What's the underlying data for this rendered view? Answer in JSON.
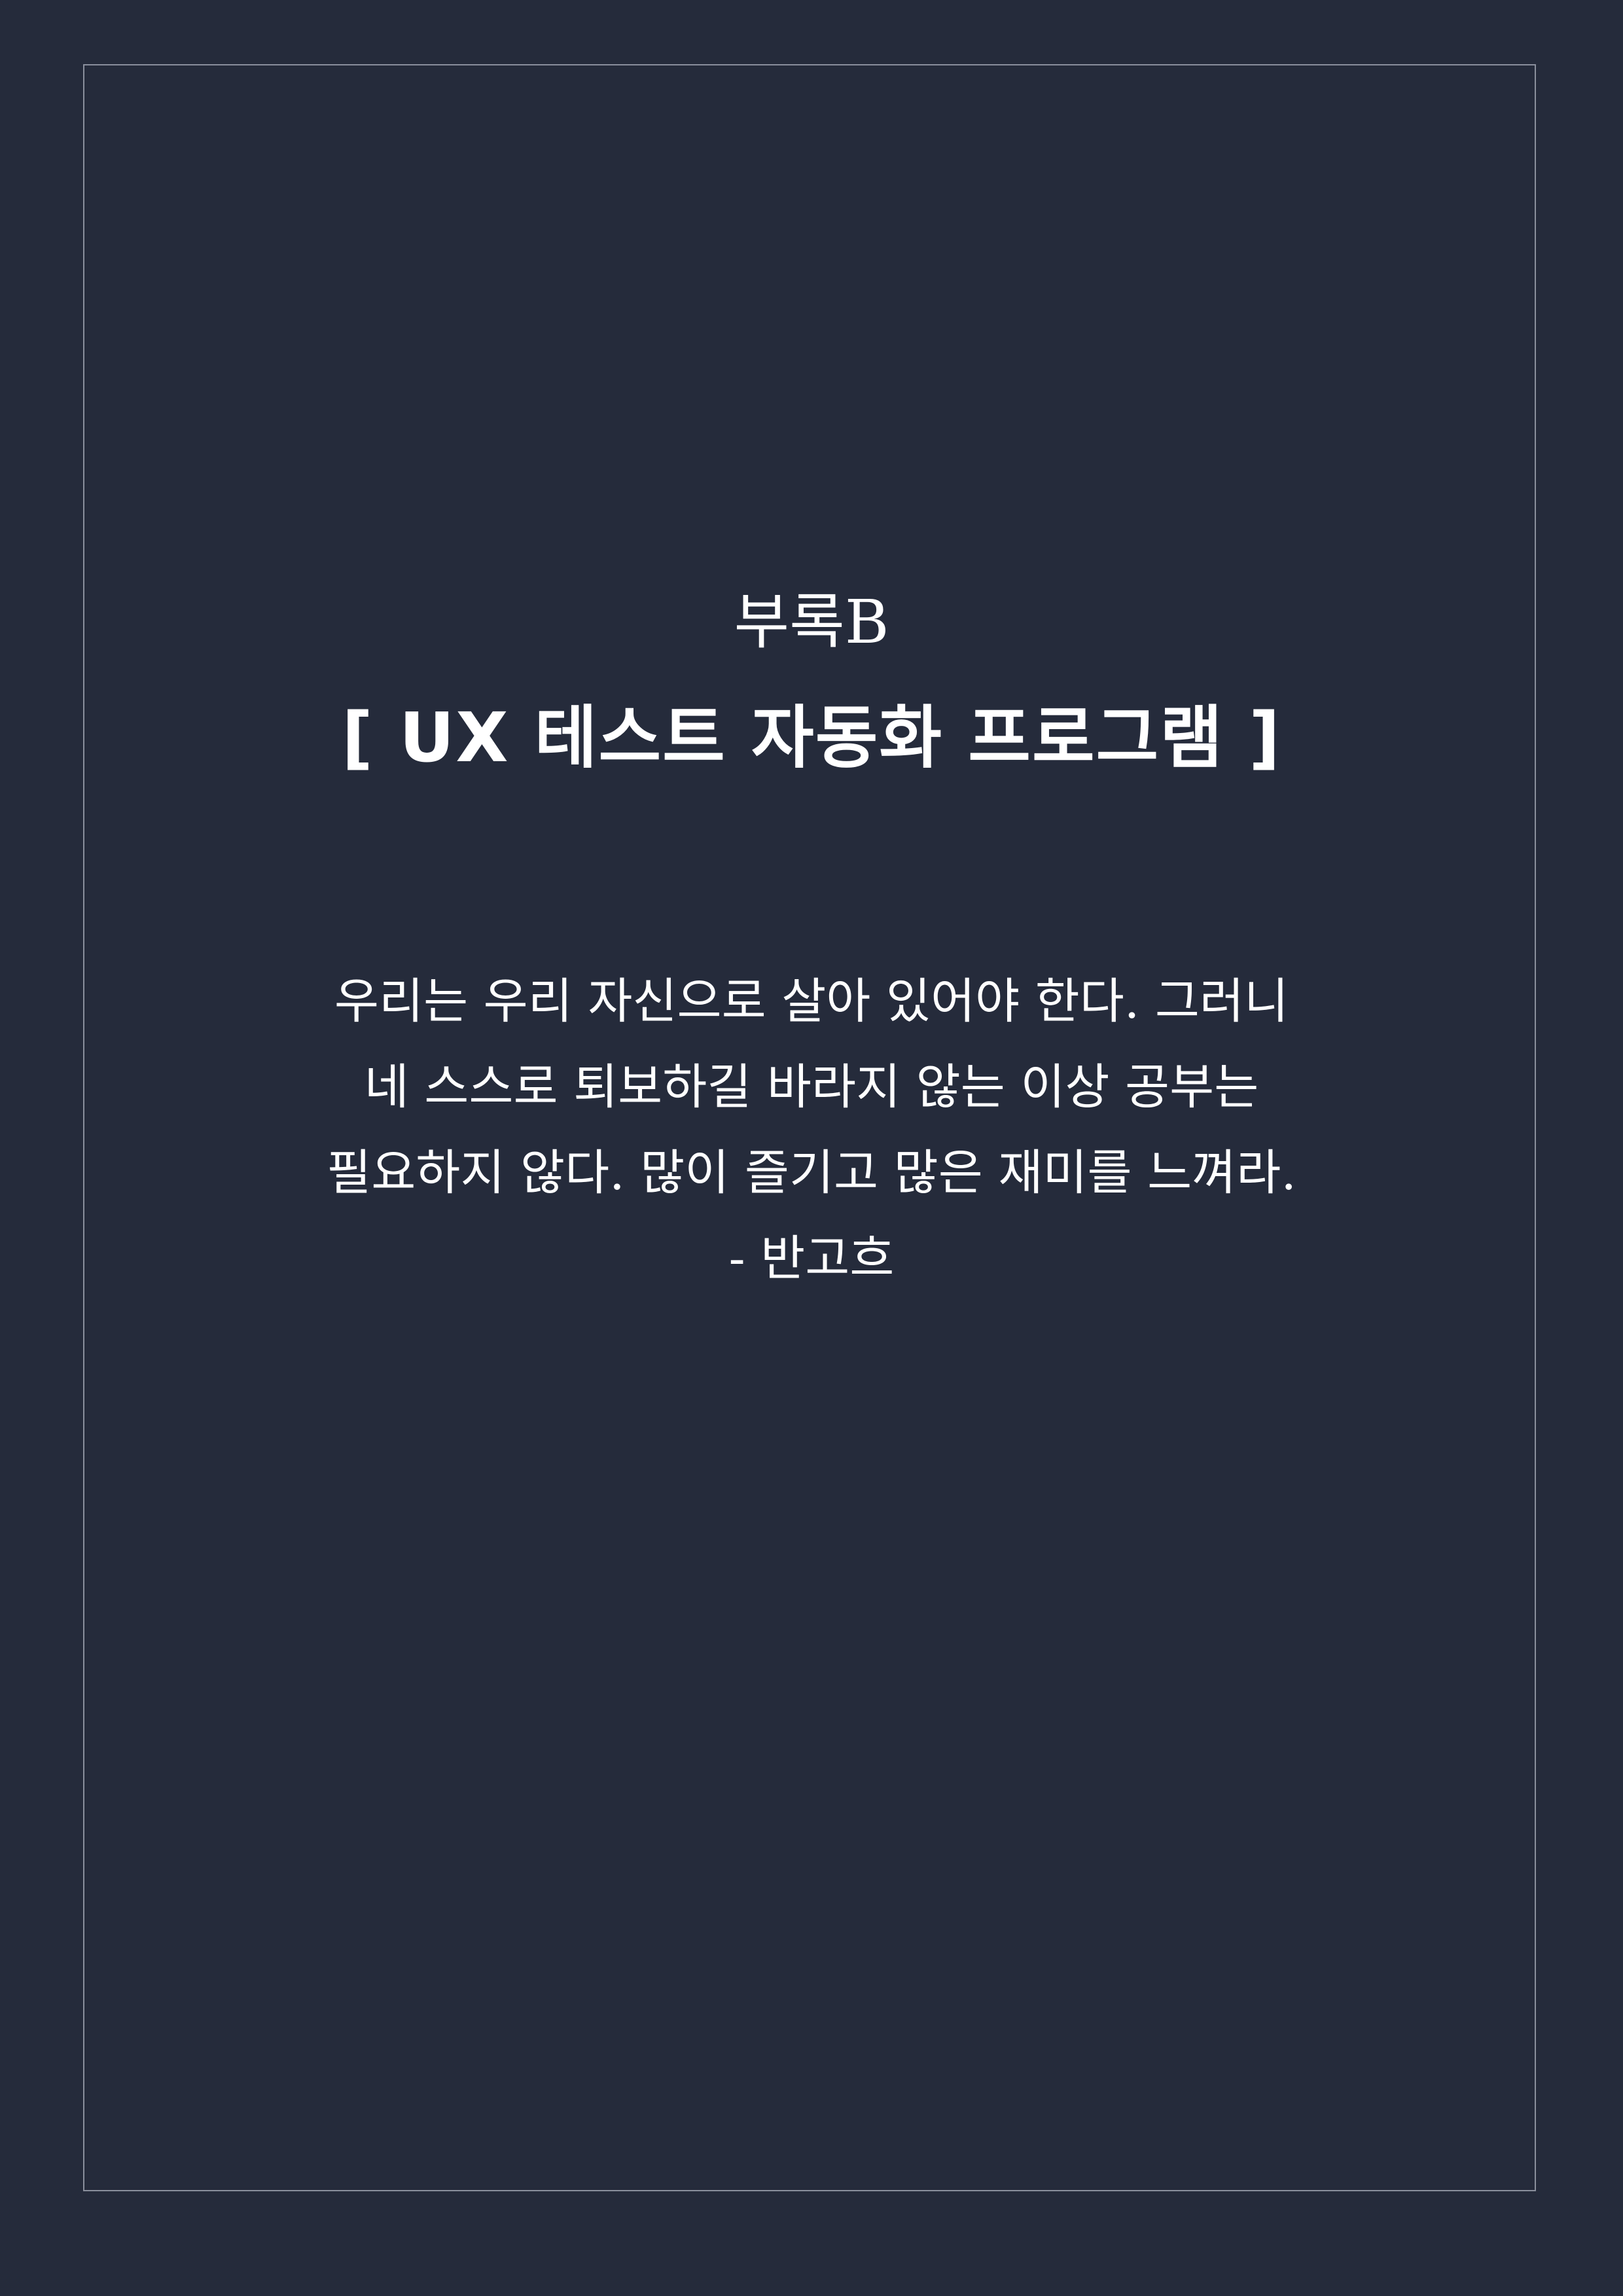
{
  "page": {
    "background_color": "#252b3b",
    "frame_color": "#8a8f9c",
    "text_color": "#ffffff"
  },
  "header": {
    "appendix_label": "부록B",
    "title": "[ UX 테스트 자동화 프로그램 ]"
  },
  "quote": {
    "lines": [
      "우리는 우리 자신으로 살아 있어야 한다. 그러니",
      "네 스스로 퇴보하길 바라지 않는 이상 공부는",
      "필요하지 않다. 많이 즐기고 많은 재미를 느껴라."
    ],
    "author": "- 반고흐"
  }
}
